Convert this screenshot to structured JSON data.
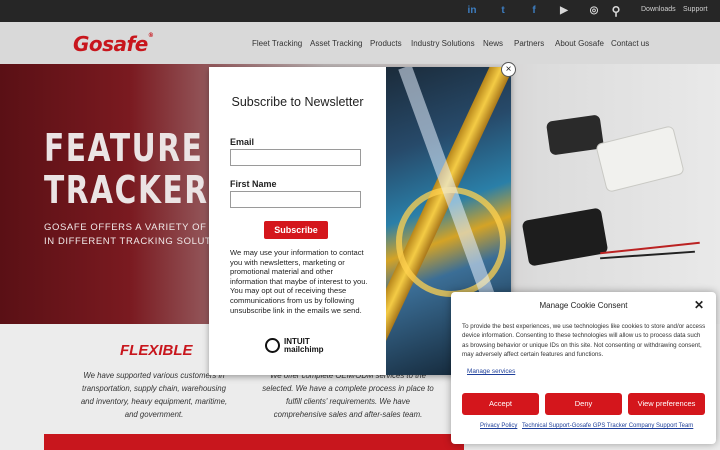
{
  "topbar": {
    "social": [
      "linkedin-icon",
      "twitter-icon",
      "facebook-icon",
      "youtube-icon",
      "instagram-icon",
      "search-icon"
    ],
    "social_glyphs": [
      "in",
      "t",
      "f",
      "▶",
      "◎",
      "⚲"
    ],
    "downloads": "Downloads",
    "support": "Support"
  },
  "header": {
    "logo": "Gosafe",
    "logo_mark": "®",
    "nav": [
      "Fleet Tracking",
      "Asset Tracking",
      "Products",
      "Industry Solutions",
      "News",
      "Partners",
      "About Gosafe",
      "Contact us"
    ]
  },
  "hero": {
    "title_line1": "FEATURE RI",
    "title_line2": "TRACKER",
    "subtitle_line1": "GOSAFE OFFERS A VARIETY OF DEVIC",
    "subtitle_line2": "IN DIFFERENT TRACKING SOLUTIONS"
  },
  "features": {
    "col1_title": "FLEXIBLE",
    "col1_text": "We have supported various customers in transportation, supply chain, warehousing and inventory, heavy equipment, maritime, and government.",
    "col2_text": "We offer complete OEM/ODM services to the selected. We have a complete process in place to fulfill clients' requirements. We have comprehensive sales and after-sales team."
  },
  "subscribe": {
    "title": "Subscribe to Newsletter",
    "email_label": "Email",
    "email_value": "",
    "first_name_label": "First Name",
    "first_name_value": "",
    "button": "Subscribe",
    "disclaimer": "We may use your information to contact you with newsletters, marketing or promotional material and other information that maybe of interest to you. You may opt out of receiving these communications from us by following unsubscribe link in the emails we send.",
    "mailchimp_line1": "INTUIT",
    "mailchimp_line2": "mailchimp",
    "close": "×"
  },
  "cookie": {
    "title": "Manage Cookie Consent",
    "close": "✕",
    "text": "To provide the best experiences, we use technologies like cookies to store and/or access device information. Consenting to these technologies will allow us to process data such as browsing behavior or unique IDs on this site. Not consenting or withdrawing consent, may adversely affect certain features and functions.",
    "manage_services": "Manage services",
    "accept": "Accept",
    "deny": "Deny",
    "view_preferences": "View preferences",
    "privacy_policy": "Privacy Policy",
    "footer_link": "Technical Support-Gosafe GPS Tracker Company Support Team"
  },
  "colors": {
    "brand_red": "#c8161d",
    "button_red": "#d4161c",
    "link_blue": "#1e3f9a",
    "topbar": "#262626",
    "header": "#d9d9d9"
  }
}
